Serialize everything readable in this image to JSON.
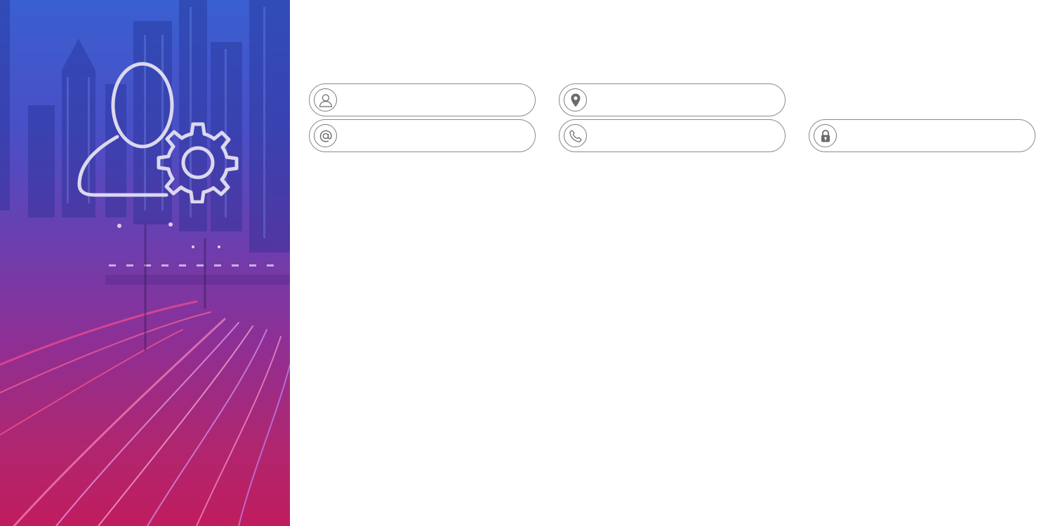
{
  "hero": {
    "illustration_icon": "user-settings-icon",
    "background": "night-city-traffic-image",
    "gradient_colors": [
      "#3a5fd0",
      "#6a3fb0",
      "#c01c5e"
    ]
  },
  "form": {
    "name": {
      "icon": "user-icon",
      "value": "",
      "placeholder": ""
    },
    "location": {
      "icon": "location-pin-icon",
      "value": "",
      "placeholder": ""
    },
    "email": {
      "icon": "at-sign-icon",
      "value": "",
      "placeholder": ""
    },
    "phone": {
      "icon": "phone-icon",
      "value": "",
      "placeholder": ""
    },
    "password": {
      "icon": "lock-icon",
      "value": "",
      "placeholder": ""
    }
  },
  "colors": {
    "field_border": "#8a8a8a",
    "icon_stroke": "#6a6a6a",
    "hero_icon_stroke": "#dcd8ee"
  }
}
